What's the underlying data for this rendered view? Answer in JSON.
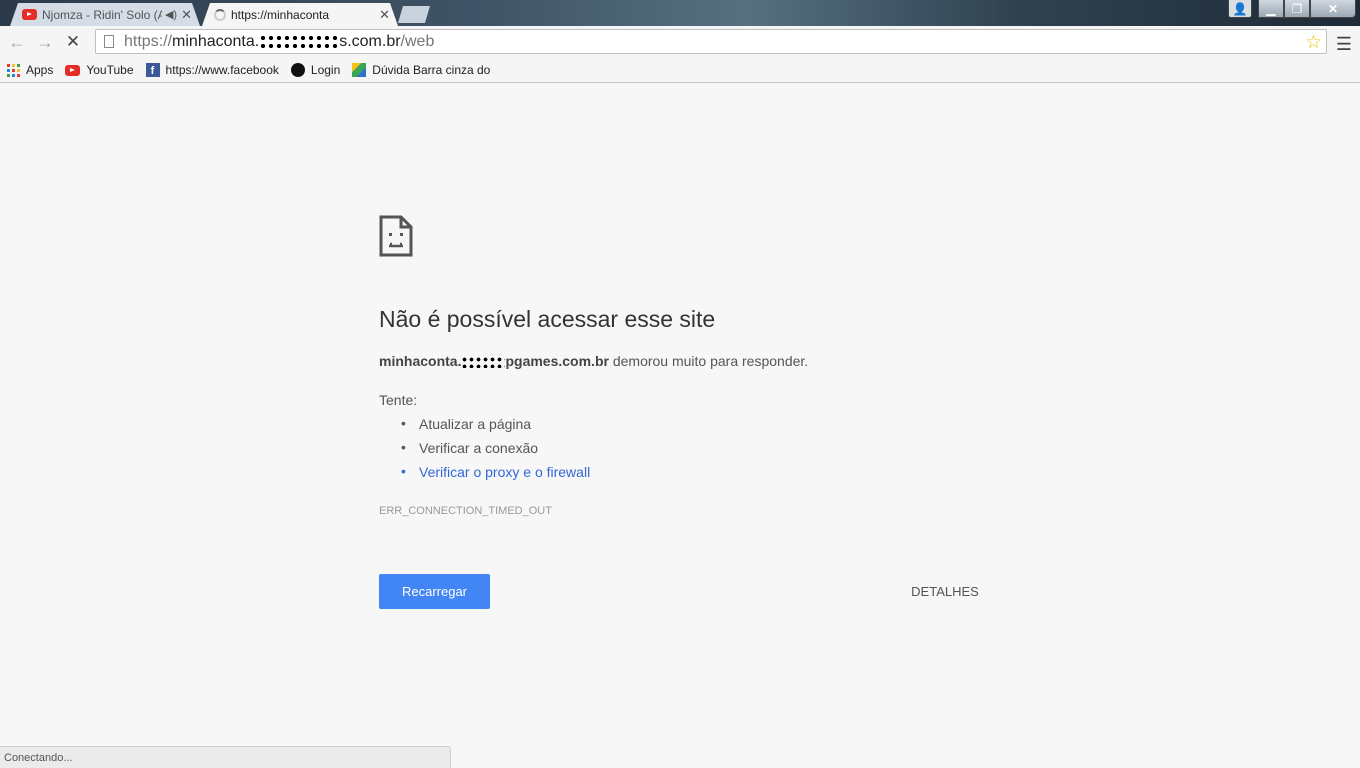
{
  "tabs": [
    {
      "title": "Njomza - Ridin' Solo (A",
      "favicon": "youtube-icon",
      "audio": true
    },
    {
      "title": "https://minhaconta",
      "favicon": "loading-spinner",
      "active": true
    }
  ],
  "toolbar": {
    "url_prefix": "https://",
    "url_host": "minhaconta.",
    "url_host_redacted": "s.com.br",
    "url_path": "/web"
  },
  "bookmarks": [
    {
      "label": "Apps",
      "icon": "apps-grid-icon"
    },
    {
      "label": "YouTube",
      "icon": "youtube-icon"
    },
    {
      "label": "https://www.facebook",
      "icon": "facebook-icon"
    },
    {
      "label": "Login",
      "icon": "bug-icon"
    },
    {
      "label": "Dúvida Barra cinza do",
      "icon": "cube-icon"
    }
  ],
  "error": {
    "title": "Não é possível acessar esse site",
    "host": "minhaconta.",
    "host_suffix": "pgames.com.br",
    "message": " demorou muito para responder.",
    "try_label": "Tente:",
    "suggestions": [
      "Atualizar a página",
      "Verificar a conexão",
      "Verificar o proxy e o firewall"
    ],
    "code": "ERR_CONNECTION_TIMED_OUT",
    "reload_label": "Recarregar",
    "details_label": "DETALHES"
  },
  "status": "Conectando...",
  "colors": {
    "accent": "#4285f4",
    "link": "#3367d6",
    "page_bg": "#f7f7f7"
  }
}
